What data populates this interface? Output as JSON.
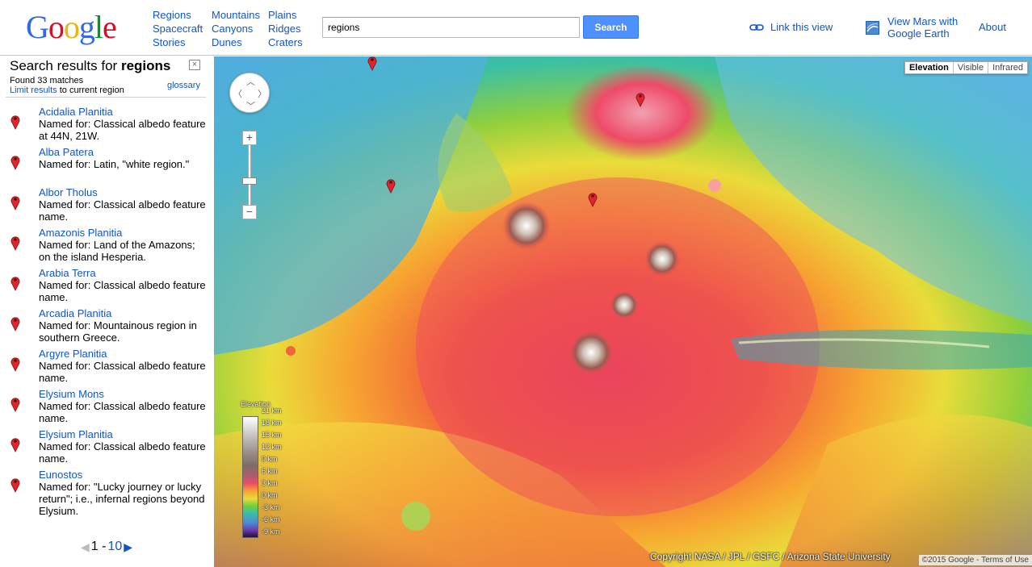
{
  "header": {
    "logo_letters": [
      "G",
      "o",
      "o",
      "g",
      "l",
      "e"
    ],
    "logo_colors": [
      "#3369e8",
      "#d50f25",
      "#eeb211",
      "#3369e8",
      "#009925",
      "#d50f25"
    ],
    "nav_col1": [
      "Regions",
      "Spacecraft",
      "Stories"
    ],
    "nav_col2": [
      "Mountains",
      "Canyons",
      "Dunes"
    ],
    "nav_col3": [
      "Plains",
      "Ridges",
      "Craters"
    ],
    "search_value": "regions",
    "search_button": "Search",
    "link_view": "Link this view",
    "earth_link": "View Mars with Google Earth",
    "about": "About"
  },
  "sidebar": {
    "title_prefix": "Search results for ",
    "title_query": "regions",
    "close": "×",
    "found": "Found 33 matches",
    "limit_link": "Limit results",
    "limit_rest": " to current region",
    "glossary": "glossary",
    "results": [
      {
        "name": "Acidalia Planitia",
        "desc": "Named for: Classical albedo feature at 44N, 21W."
      },
      {
        "name": "Alba Patera",
        "desc": "Named for: Latin, \"white region.\""
      },
      {
        "name": "Albor Tholus",
        "desc": "Named for: Classical albedo feature name."
      },
      {
        "name": "Amazonis Planitia",
        "desc": "Named for: Land of the Amazons; on the island Hesperia."
      },
      {
        "name": "Arabia Terra",
        "desc": "Named for: Classical albedo feature name."
      },
      {
        "name": "Arcadia Planitia",
        "desc": "Named for: Mountainous region in southern Greece."
      },
      {
        "name": "Argyre Planitia",
        "desc": "Named for: Classical albedo feature name."
      },
      {
        "name": "Elysium Mons",
        "desc": "Named for: Classical albedo feature name."
      },
      {
        "name": "Elysium Planitia",
        "desc": "Named for: Classical albedo feature name."
      },
      {
        "name": "Eunostos",
        "desc": "Named for: \"Lucky journey or lucky return\"; i.e., infernal regions beyond Elysium."
      }
    ],
    "pager_range": "1 - ",
    "pager_end": "10"
  },
  "map": {
    "maptypes": [
      "Elevation",
      "Visible",
      "Infrared"
    ],
    "selected_maptype": "Elevation",
    "zoom_plus": "+",
    "zoom_minus": "−",
    "legend_title": "Elevation",
    "legend_labels": [
      "21 km",
      "18 km",
      "15 km",
      "12 km",
      "9 km",
      "6 km",
      "3 km",
      "0 km",
      "-3 km",
      "-6 km",
      "-9 km"
    ],
    "copyright": "Copyright NASA / JPL / GSFC / Arizona State University",
    "footer_year": "©2015 Google",
    "footer_sep": " - ",
    "terms": "Terms of Use",
    "colors": {
      "accent": "#1155cc",
      "pin": "#e0262d"
    }
  }
}
